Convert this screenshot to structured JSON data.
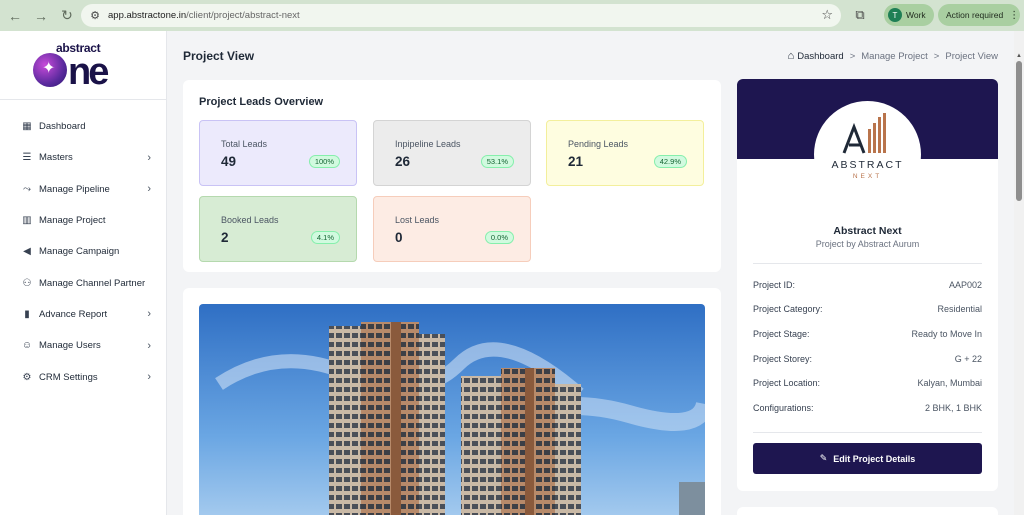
{
  "browser": {
    "url_host": "app.abstractone.in",
    "url_path": "/client/project/abstract-next",
    "profile_initial": "T",
    "profile_label": "Work",
    "action_label": "Action required"
  },
  "logo": {
    "small": "abstract",
    "big": "ne"
  },
  "sidebar": {
    "items": [
      {
        "label": "Dashboard",
        "icon": "grid-icon",
        "expandable": false
      },
      {
        "label": "Masters",
        "icon": "list-icon",
        "expandable": true
      },
      {
        "label": "Manage Pipeline",
        "icon": "pipeline-icon",
        "expandable": true
      },
      {
        "label": "Manage Project",
        "icon": "building-icon",
        "expandable": false
      },
      {
        "label": "Manage Campaign",
        "icon": "megaphone-icon",
        "expandable": false
      },
      {
        "label": "Manage Channel Partner",
        "icon": "handshake-icon",
        "expandable": false
      },
      {
        "label": "Advance Report",
        "icon": "bar-chart-icon",
        "expandable": true
      },
      {
        "label": "Manage Users",
        "icon": "users-icon",
        "expandable": true
      },
      {
        "label": "CRM Settings",
        "icon": "gear-icon",
        "expandable": true
      }
    ]
  },
  "header": {
    "title": "Project View",
    "breadcrumb": [
      "Dashboard",
      "Manage Project",
      "Project View"
    ],
    "separator": ">"
  },
  "overview": {
    "title": "Project Leads Overview",
    "stats": [
      {
        "label": "Total Leads",
        "value": "49",
        "badge": "100%",
        "bg": "#eceafc",
        "border": "#c9c3f5"
      },
      {
        "label": "Inpipeline Leads",
        "value": "26",
        "badge": "53.1%",
        "bg": "#ececec",
        "border": "#d4d4d4"
      },
      {
        "label": "Pending Leads",
        "value": "21",
        "badge": "42.9%",
        "bg": "#fefde0",
        "border": "#f3ef9c"
      },
      {
        "label": "Booked Leads",
        "value": "2",
        "badge": "4.1%",
        "bg": "#d7ecd4",
        "border": "#b5d9ae"
      },
      {
        "label": "Lost Leads",
        "value": "0",
        "badge": "0.0%",
        "bg": "#fdece4",
        "border": "#f6cdbb"
      }
    ]
  },
  "project": {
    "logo_text": "ABSTRACT",
    "logo_sub": "NEXT",
    "name": "Abstract Next",
    "subtitle": "Project by Abstract Aurum",
    "details": [
      {
        "key": "Project ID:",
        "value": "AAP002"
      },
      {
        "key": "Project Category:",
        "value": "Residential"
      },
      {
        "key": "Project Stage:",
        "value": "Ready to Move In"
      },
      {
        "key": "Project Storey:",
        "value": "G + 22"
      },
      {
        "key": "Project Location:",
        "value": "Kalyan, Mumbai"
      },
      {
        "key": "Configurations:",
        "value": "2 BHK, 1 BHK"
      }
    ],
    "edit_label": "Edit Project Details"
  },
  "colors": {
    "brand": "#1e1650",
    "chrome": "#d3e3d0"
  }
}
